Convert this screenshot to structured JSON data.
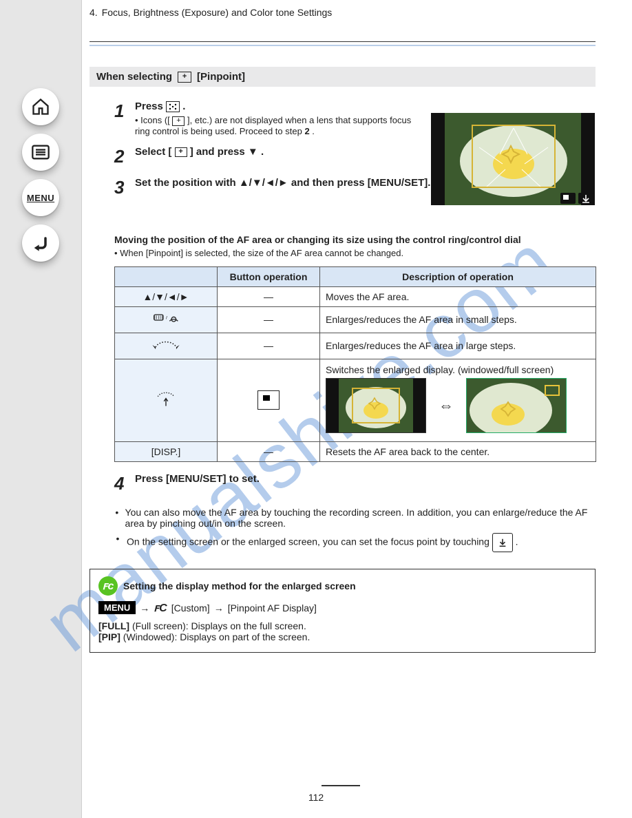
{
  "breadcrumb": {
    "chapter_num": "4.",
    "chapter_title": "Focus, Brightness (Exposure) and Color tone Settings"
  },
  "section": {
    "prefix_label": "When selecting",
    "suffix_label": "[Pinpoint]"
  },
  "steps": {
    "s1": {
      "num": "1",
      "main_prefix": "Press ",
      "main_icon_name": "five-point-af-icon",
      "main_suffix": ".",
      "sub_prefix": "• Icons ([",
      "sub_mid": "], etc.) are not displayed when a lens that supports ",
      "sub_mid2": "focus ring control is being used. Proceed to step ",
      "sub_step_ref": "2",
      "sub_suffix": "."
    },
    "s2": {
      "num": "2",
      "main_a": "Select [",
      "main_b": "] and press ",
      "main_c": "."
    },
    "s3": {
      "num": "3",
      "main": "Set the position with ▲/▼/◄/► and then press [MENU/SET]."
    }
  },
  "spot_block": {
    "title": "Moving the position of the AF area or changing its size using the control ring/control dial",
    "note": "• When [Pinpoint] is selected, the size of the AF area cannot be changed."
  },
  "table": {
    "head": {
      "control": "",
      "button": "Button operation",
      "desc": "Description of operation"
    },
    "rows": {
      "cursor": {
        "control": "▲/▼/◄/►",
        "button": "—",
        "desc": "Moves the AF area."
      },
      "ringdial": {
        "control_icon": "dial",
        "button": "—",
        "desc": "Enlarges/reduces the AF area in small steps."
      },
      "lever_l": {
        "control_icon": "lever-left",
        "button": "—",
        "desc": "Enlarges/reduces the AF area in large steps."
      },
      "lever_r": {
        "control_icon": "lever-right",
        "button_icon": "disp-tile",
        "desc": "Switches the enlarged display. (windowed/full screen)"
      },
      "disp": {
        "control": "[DISP.]",
        "button": "—",
        "desc": "Resets the AF area back to the center."
      }
    }
  },
  "after_table": {
    "step4": {
      "num": "4",
      "main": "Press [MENU/SET] to set."
    }
  },
  "bullets": {
    "b1_a": "You can also move the AF area by touching the recording screen. In addition, you can enlarge/reduce the AF area by pinching out/in on the screen.",
    "b2_a": "On the setting screen or the enlarged screen, you can set the focus point by touching ",
    "b2_b": "."
  },
  "tip": {
    "title": "Setting the display method for the enlarged screen",
    "chain": {
      "menu": "MENU",
      "arrow1": "→",
      "cat": "fC",
      "cat_text": " [Custom]",
      "arrow2": "→",
      "item": "[Pinpoint AF Display]"
    },
    "opt1": {
      "name": "[FULL]",
      "text": "(Full screen): Displays on the full screen."
    },
    "opt2": {
      "name": "[PIP]",
      "text": "(Windowed): Displays on part of the screen."
    }
  },
  "watermark_text": "manualshive.com",
  "page_number": "112"
}
